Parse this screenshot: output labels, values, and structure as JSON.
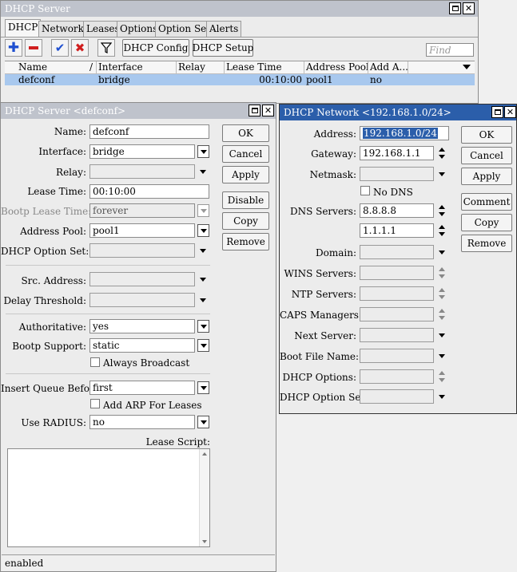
{
  "main_window": {
    "title": "DHCP Server",
    "tabs": [
      "DHCP",
      "Networks",
      "Leases",
      "Options",
      "Option Sets",
      "Alerts"
    ],
    "toolbar": {
      "config_label": "DHCP Config",
      "setup_label": "DHCP Setup",
      "find_placeholder": "Find"
    },
    "table": {
      "headers": [
        "Name",
        "/",
        "Interface",
        "Relay",
        "Lease Time",
        "Address Pool",
        "Add A..."
      ],
      "rows": [
        {
          "name": "defconf",
          "interface": "bridge",
          "relay": "",
          "lease_time": "00:10:00",
          "address_pool": "pool1",
          "add_arp": "no"
        }
      ]
    }
  },
  "server_dialog": {
    "title": "DHCP Server <defconf>",
    "labels": {
      "name": "Name:",
      "interface": "Interface:",
      "relay": "Relay:",
      "lease_time": "Lease Time:",
      "bootp_lease_time": "Bootp Lease Time:",
      "address_pool": "Address Pool:",
      "dhcp_option_set": "DHCP Option Set:",
      "src_address": "Src. Address:",
      "delay_threshold": "Delay Threshold:",
      "authoritative": "Authoritative:",
      "bootp_support": "Bootp Support:",
      "always_broadcast": "Always Broadcast",
      "insert_queue_before": "Insert Queue Before:",
      "add_arp": "Add ARP For Leases",
      "use_radius": "Use RADIUS:",
      "lease_script": "Lease Script:"
    },
    "values": {
      "name": "defconf",
      "interface": "bridge",
      "lease_time": "00:10:00",
      "bootp_lease_time": "forever",
      "address_pool": "pool1",
      "authoritative": "yes",
      "bootp_support": "static",
      "insert_queue_before": "first",
      "use_radius": "no"
    },
    "buttons": {
      "ok": "OK",
      "cancel": "Cancel",
      "apply": "Apply",
      "disable": "Disable",
      "copy": "Copy",
      "remove": "Remove"
    },
    "status": "enabled"
  },
  "network_dialog": {
    "title": "DHCP Network <192.168.1.0/24>",
    "labels": {
      "address": "Address:",
      "gateway": "Gateway:",
      "netmask": "Netmask:",
      "no_dns": "No DNS",
      "dns_servers": "DNS Servers:",
      "domain": "Domain:",
      "wins_servers": "WINS Servers:",
      "ntp_servers": "NTP Servers:",
      "caps_managers": "CAPS Managers:",
      "next_server": "Next Server:",
      "boot_file_name": "Boot File Name:",
      "dhcp_options": "DHCP Options:",
      "dhcp_option_set": "DHCP Option Set:"
    },
    "values": {
      "address": "192.168.1.0/24",
      "gateway": "192.168.1.1",
      "dns1": "8.8.8.8",
      "dns2": "1.1.1.1"
    },
    "buttons": {
      "ok": "OK",
      "cancel": "Cancel",
      "apply": "Apply",
      "comment": "Comment",
      "copy": "Copy",
      "remove": "Remove"
    }
  },
  "colors": {
    "titlebar_active": "#2b5eaa",
    "titlebar_inactive": "#bfc3cc",
    "selection": "#a8c8ee",
    "add_icon": "#1e4fd0",
    "remove_icon": "#d01e1e"
  }
}
